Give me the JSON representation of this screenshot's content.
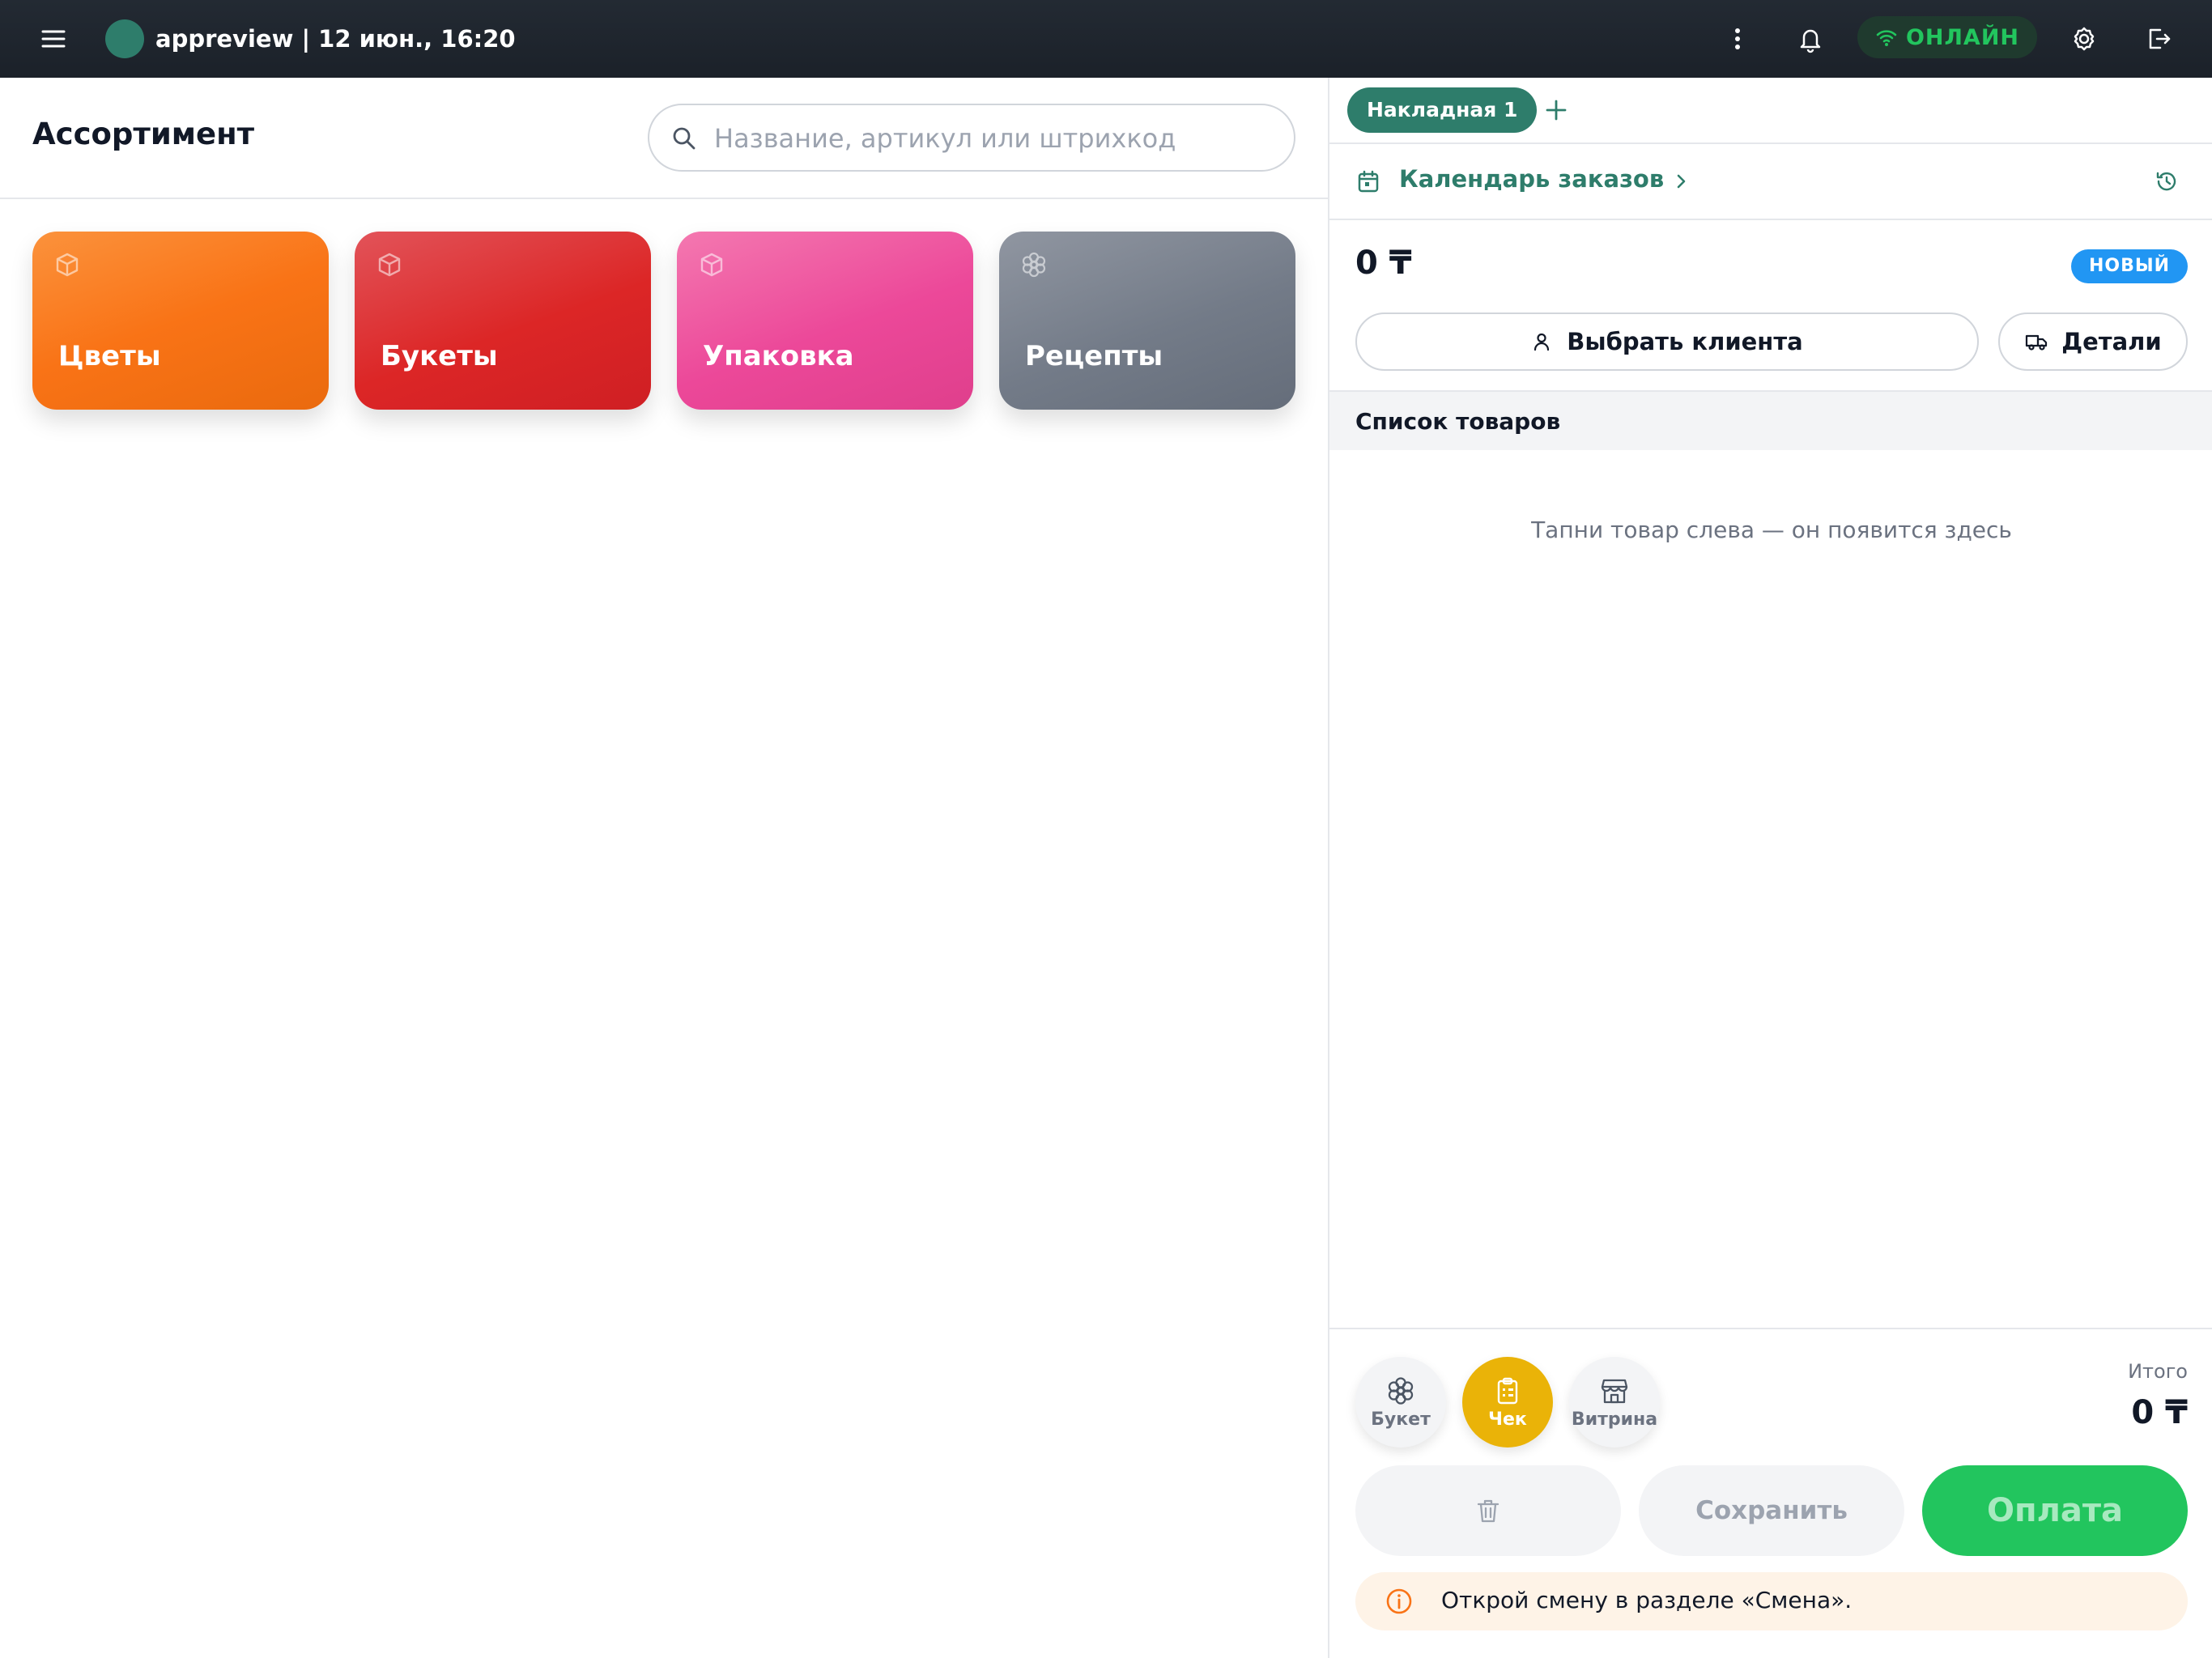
{
  "header": {
    "title": "appreview | 12 июн., 16:20",
    "status": "ОНЛАЙН",
    "avatar_color": "#2e7d6b",
    "status_color": "#22c55e",
    "icons": [
      "menu-icon",
      "more-vertical-icon",
      "bell-icon",
      "wifi-icon",
      "gear-icon",
      "logout-icon"
    ]
  },
  "assortment": {
    "title": "Ассортимент",
    "search_placeholder": "Название, артикул или штрихкод",
    "categories": [
      {
        "label": "Цветы",
        "color": "#f97316",
        "icon": "box-icon"
      },
      {
        "label": "Букеты",
        "color": "#dc2626",
        "icon": "box-icon"
      },
      {
        "label": "Упаковка",
        "color": "#ec4899",
        "icon": "box-icon"
      },
      {
        "label": "Рецепты",
        "color": "#737b88",
        "icon": "flower-icon"
      }
    ]
  },
  "order": {
    "tab_label": "Накладная 1",
    "calendar_label": "Календарь заказов",
    "amount": "0 ₸",
    "status_badge": "НОВЫЙ",
    "client_button": "Выбрать клиента",
    "details_button": "Детали",
    "list_title": "Список товаров",
    "empty_hint": "Тапни товар слева — он появится здесь",
    "modes": [
      {
        "label": "Букет",
        "icon": "flower-icon",
        "active": false
      },
      {
        "label": "Чек",
        "icon": "clipboard-icon",
        "active": true
      },
      {
        "label": "Витрина",
        "icon": "storefront-icon",
        "active": false
      }
    ],
    "total_label": "Итого",
    "total_value": "0 ₸",
    "save_button": "Сохранить",
    "pay_button": "Оплата",
    "notice": "Открой смену в разделе «Смена».",
    "accent_color": "#2e7d6b",
    "pay_color": "#22c55e",
    "active_mode_color": "#eab308"
  }
}
